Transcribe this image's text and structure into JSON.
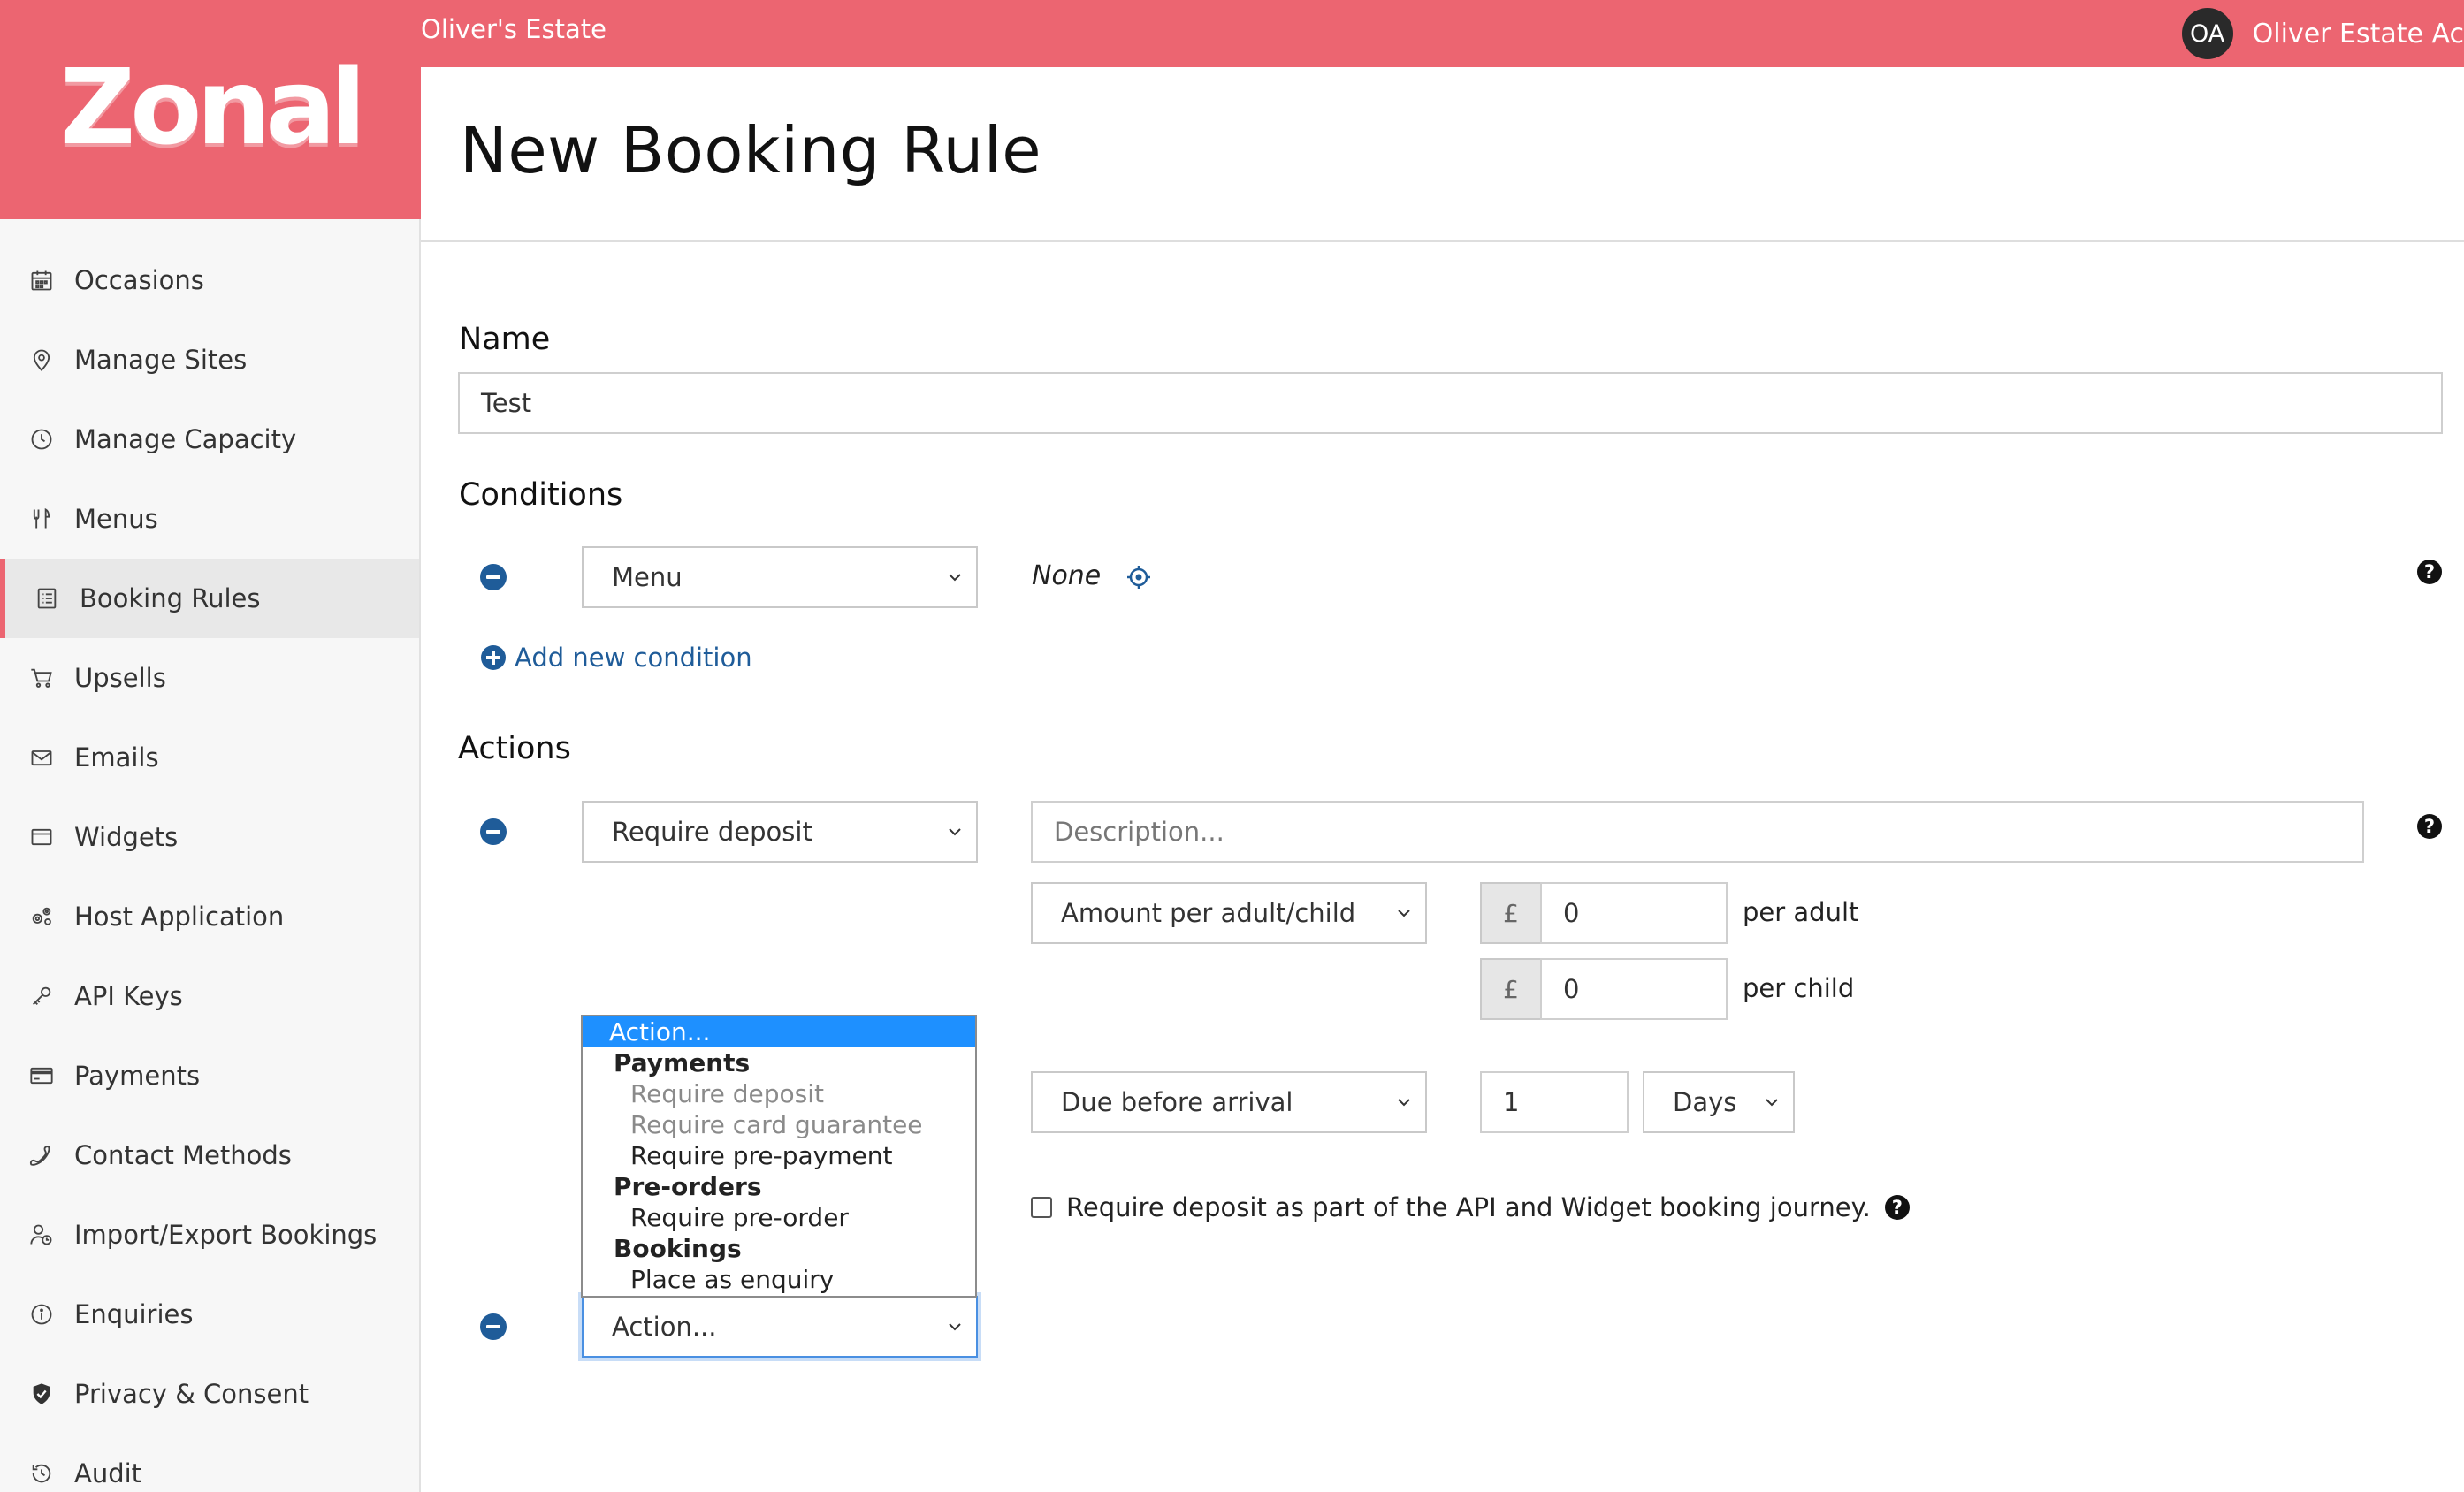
{
  "topbar": {
    "estate_name": "Oliver's Estate",
    "user_initials": "OA",
    "user_name": "Oliver Estate Ac"
  },
  "brand": {
    "logo_text": "Zonal",
    "color": "#ec6571"
  },
  "sidebar": {
    "items": [
      {
        "label": "Occasions",
        "icon": "calendar-icon",
        "active": false
      },
      {
        "label": "Manage Sites",
        "icon": "map-pin-icon",
        "active": false
      },
      {
        "label": "Manage Capacity",
        "icon": "clock-icon",
        "active": false
      },
      {
        "label": "Menus",
        "icon": "cutlery-icon",
        "active": false
      },
      {
        "label": "Booking Rules",
        "icon": "list-icon",
        "active": true
      },
      {
        "label": "Upsells",
        "icon": "cart-icon",
        "active": false
      },
      {
        "label": "Emails",
        "icon": "envelope-icon",
        "active": false
      },
      {
        "label": "Widgets",
        "icon": "window-icon",
        "active": false
      },
      {
        "label": "Host Application",
        "icon": "gears-icon",
        "active": false
      },
      {
        "label": "API Keys",
        "icon": "key-icon",
        "active": false
      },
      {
        "label": "Payments",
        "icon": "credit-card-icon",
        "active": false
      },
      {
        "label": "Contact Methods",
        "icon": "phone-icon",
        "active": false
      },
      {
        "label": "Import/Export Bookings",
        "icon": "user-clock-icon",
        "active": false
      },
      {
        "label": "Enquiries",
        "icon": "info-icon",
        "active": false
      },
      {
        "label": "Privacy & Consent",
        "icon": "shield-check-icon",
        "active": false
      },
      {
        "label": "Audit",
        "icon": "history-icon",
        "active": false
      }
    ]
  },
  "page": {
    "title": "New Booking Rule"
  },
  "form": {
    "name_label": "Name",
    "name_value": "Test",
    "conditions_label": "Conditions",
    "condition": {
      "type": "Menu",
      "value": "None"
    },
    "add_condition_label": "Add new condition",
    "actions_label": "Actions",
    "action1": {
      "type": "Require deposit",
      "description_placeholder": "Description...",
      "amount_type": "Amount per adult/child",
      "currency_symbol": "£",
      "adult_amount": "0",
      "adult_unit": "per adult",
      "child_amount": "0",
      "child_unit": "per child",
      "due_type": "Due before arrival",
      "due_value": "1",
      "due_unit": "Days",
      "api_checkbox_label": "Require deposit as part of the API and Widget booking journey.",
      "api_checkbox_checked": false
    },
    "action2": {
      "type": "Action..."
    }
  },
  "dropdown": {
    "selected": "Action...",
    "groups": [
      {
        "label": "Payments",
        "options": [
          {
            "label": "Require deposit",
            "disabled": true
          },
          {
            "label": "Require card guarantee",
            "disabled": true
          },
          {
            "label": "Require pre-payment",
            "disabled": false
          }
        ]
      },
      {
        "label": "Pre-orders",
        "options": [
          {
            "label": "Require pre-order",
            "disabled": false
          }
        ]
      },
      {
        "label": "Bookings",
        "options": [
          {
            "label": "Place as enquiry",
            "disabled": false
          }
        ]
      }
    ]
  },
  "colors": {
    "accent": "#ec6571",
    "link": "#1f5c99",
    "selection": "#1e90ff"
  }
}
